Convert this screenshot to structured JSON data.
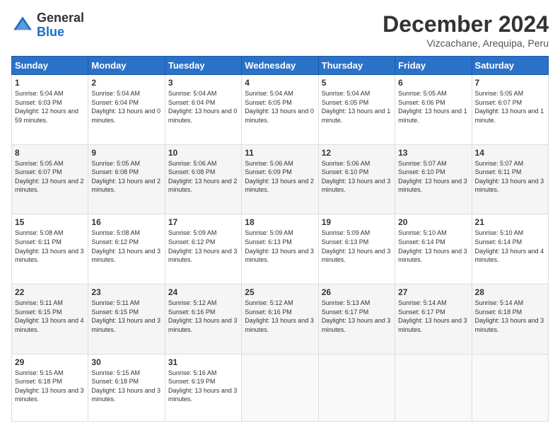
{
  "logo": {
    "general": "General",
    "blue": "Blue"
  },
  "title": "December 2024",
  "subtitle": "Vizcachane, Arequipa, Peru",
  "days_of_week": [
    "Sunday",
    "Monday",
    "Tuesday",
    "Wednesday",
    "Thursday",
    "Friday",
    "Saturday"
  ],
  "weeks": [
    [
      {
        "day": "1",
        "sunrise": "5:04 AM",
        "sunset": "6:03 PM",
        "daylight": "12 hours and 59 minutes."
      },
      {
        "day": "2",
        "sunrise": "5:04 AM",
        "sunset": "6:04 PM",
        "daylight": "13 hours and 0 minutes."
      },
      {
        "day": "3",
        "sunrise": "5:04 AM",
        "sunset": "6:04 PM",
        "daylight": "13 hours and 0 minutes."
      },
      {
        "day": "4",
        "sunrise": "5:04 AM",
        "sunset": "6:05 PM",
        "daylight": "13 hours and 0 minutes."
      },
      {
        "day": "5",
        "sunrise": "5:04 AM",
        "sunset": "6:05 PM",
        "daylight": "13 hours and 1 minute."
      },
      {
        "day": "6",
        "sunrise": "5:05 AM",
        "sunset": "6:06 PM",
        "daylight": "13 hours and 1 minute."
      },
      {
        "day": "7",
        "sunrise": "5:05 AM",
        "sunset": "6:07 PM",
        "daylight": "13 hours and 1 minute."
      }
    ],
    [
      {
        "day": "8",
        "sunrise": "5:05 AM",
        "sunset": "6:07 PM",
        "daylight": "13 hours and 2 minutes."
      },
      {
        "day": "9",
        "sunrise": "5:05 AM",
        "sunset": "6:08 PM",
        "daylight": "13 hours and 2 minutes."
      },
      {
        "day": "10",
        "sunrise": "5:06 AM",
        "sunset": "6:08 PM",
        "daylight": "13 hours and 2 minutes."
      },
      {
        "day": "11",
        "sunrise": "5:06 AM",
        "sunset": "6:09 PM",
        "daylight": "13 hours and 2 minutes."
      },
      {
        "day": "12",
        "sunrise": "5:06 AM",
        "sunset": "6:10 PM",
        "daylight": "13 hours and 3 minutes."
      },
      {
        "day": "13",
        "sunrise": "5:07 AM",
        "sunset": "6:10 PM",
        "daylight": "13 hours and 3 minutes."
      },
      {
        "day": "14",
        "sunrise": "5:07 AM",
        "sunset": "6:11 PM",
        "daylight": "13 hours and 3 minutes."
      }
    ],
    [
      {
        "day": "15",
        "sunrise": "5:08 AM",
        "sunset": "6:11 PM",
        "daylight": "13 hours and 3 minutes."
      },
      {
        "day": "16",
        "sunrise": "5:08 AM",
        "sunset": "6:12 PM",
        "daylight": "13 hours and 3 minutes."
      },
      {
        "day": "17",
        "sunrise": "5:09 AM",
        "sunset": "6:12 PM",
        "daylight": "13 hours and 3 minutes."
      },
      {
        "day": "18",
        "sunrise": "5:09 AM",
        "sunset": "6:13 PM",
        "daylight": "13 hours and 3 minutes."
      },
      {
        "day": "19",
        "sunrise": "5:09 AM",
        "sunset": "6:13 PM",
        "daylight": "13 hours and 3 minutes."
      },
      {
        "day": "20",
        "sunrise": "5:10 AM",
        "sunset": "6:14 PM",
        "daylight": "13 hours and 3 minutes."
      },
      {
        "day": "21",
        "sunrise": "5:10 AM",
        "sunset": "6:14 PM",
        "daylight": "13 hours and 4 minutes."
      }
    ],
    [
      {
        "day": "22",
        "sunrise": "5:11 AM",
        "sunset": "6:15 PM",
        "daylight": "13 hours and 4 minutes."
      },
      {
        "day": "23",
        "sunrise": "5:11 AM",
        "sunset": "6:15 PM",
        "daylight": "13 hours and 3 minutes."
      },
      {
        "day": "24",
        "sunrise": "5:12 AM",
        "sunset": "6:16 PM",
        "daylight": "13 hours and 3 minutes."
      },
      {
        "day": "25",
        "sunrise": "5:12 AM",
        "sunset": "6:16 PM",
        "daylight": "13 hours and 3 minutes."
      },
      {
        "day": "26",
        "sunrise": "5:13 AM",
        "sunset": "6:17 PM",
        "daylight": "13 hours and 3 minutes."
      },
      {
        "day": "27",
        "sunrise": "5:14 AM",
        "sunset": "6:17 PM",
        "daylight": "13 hours and 3 minutes."
      },
      {
        "day": "28",
        "sunrise": "5:14 AM",
        "sunset": "6:18 PM",
        "daylight": "13 hours and 3 minutes."
      }
    ],
    [
      {
        "day": "29",
        "sunrise": "5:15 AM",
        "sunset": "6:18 PM",
        "daylight": "13 hours and 3 minutes."
      },
      {
        "day": "30",
        "sunrise": "5:15 AM",
        "sunset": "6:18 PM",
        "daylight": "13 hours and 3 minutes."
      },
      {
        "day": "31",
        "sunrise": "5:16 AM",
        "sunset": "6:19 PM",
        "daylight": "13 hours and 3 minutes."
      },
      null,
      null,
      null,
      null
    ]
  ]
}
